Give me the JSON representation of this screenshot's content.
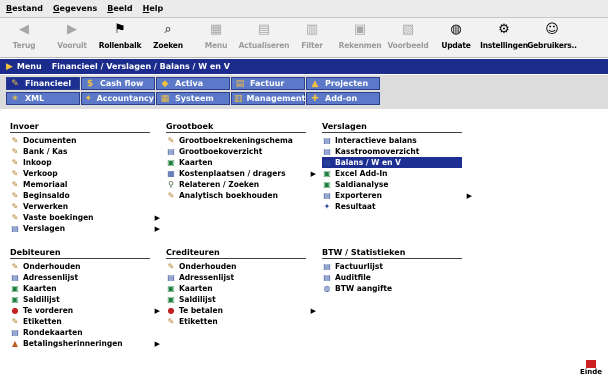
{
  "menubar": [
    "Bestand",
    "Gegevens",
    "Beeld",
    "Help"
  ],
  "toolbar": [
    {
      "label": "Terug",
      "icon": "back-icon",
      "glyph": "◀",
      "enabled": false
    },
    {
      "label": "Vooruit",
      "icon": "forward-icon",
      "glyph": "▶",
      "enabled": false
    },
    {
      "label": "Rollenbalk",
      "icon": "rollenbalk-icon",
      "glyph": "⚑",
      "enabled": true
    },
    {
      "label": "Zoeken",
      "icon": "search-icon",
      "glyph": "⌕",
      "enabled": true
    },
    {
      "label": "Menu",
      "icon": "menu-grid-icon",
      "glyph": "▦",
      "enabled": false
    },
    {
      "label": "Actualiseren",
      "icon": "refresh-icon",
      "glyph": "▤",
      "enabled": false
    },
    {
      "label": "Filter",
      "icon": "filter-icon",
      "glyph": "▥",
      "enabled": false
    },
    {
      "label": "Rekenmen",
      "icon": "calculator-icon",
      "glyph": "▣",
      "enabled": false
    },
    {
      "label": "Voorbeeld",
      "icon": "preview-icon",
      "glyph": "▧",
      "enabled": false
    },
    {
      "label": "Update",
      "icon": "globe-icon",
      "glyph": "◍",
      "enabled": true
    },
    {
      "label": "Instellingen",
      "icon": "gear-icon",
      "glyph": "⚙",
      "enabled": true
    },
    {
      "label": "Gebruikers..",
      "icon": "users-icon",
      "glyph": "☺",
      "enabled": true
    }
  ],
  "breadcrumb": {
    "menu": "Menu",
    "path": "Financieel / Verslagen / Balans / W en V"
  },
  "tabs_row1": [
    {
      "label": "Financieel",
      "icon": "bookkeeping-icon",
      "glyph": "✎",
      "active": true
    },
    {
      "label": "Cash flow",
      "icon": "cash-flow-icon",
      "glyph": "$"
    },
    {
      "label": "Activa",
      "icon": "activa-icon",
      "glyph": "◆"
    },
    {
      "label": "Factuur",
      "icon": "invoice-icon",
      "glyph": "▤"
    },
    {
      "label": "Projecten",
      "icon": "projects-icon",
      "glyph": "▲"
    }
  ],
  "tabs_row2": [
    {
      "label": "XML",
      "icon": "xml-icon",
      "glyph": "✶"
    },
    {
      "label": "Accountancy",
      "icon": "accountancy-icon",
      "glyph": "✦"
    },
    {
      "label": "Systeem",
      "icon": "system-icon",
      "glyph": "▦"
    },
    {
      "label": "Management",
      "icon": "management-icon",
      "glyph": "▥"
    },
    {
      "label": "Add-on",
      "icon": "add-on-icon",
      "glyph": "✚"
    }
  ],
  "groups": [
    {
      "title": "Invoer",
      "items": [
        {
          "label": "Documenten",
          "icon": "document-icon",
          "glyph": "✎",
          "color": "#b07a20"
        },
        {
          "label": "Bank / Kas",
          "icon": "bank-icon",
          "glyph": "✎",
          "color": "#b07a20"
        },
        {
          "label": "Inkoop",
          "icon": "purchase-icon",
          "glyph": "✎",
          "color": "#b07a20"
        },
        {
          "label": "Verkoop",
          "icon": "sales-icon",
          "glyph": "✎",
          "color": "#b07a20"
        },
        {
          "label": "Memoriaal",
          "icon": "memorial-icon",
          "glyph": "✎",
          "color": "#b07a20"
        },
        {
          "label": "Beginsaldo",
          "icon": "opening-balance-icon",
          "glyph": "✎",
          "color": "#b07a20"
        },
        {
          "label": "Verwerken",
          "icon": "process-icon",
          "glyph": "✎",
          "color": "#b07a20"
        },
        {
          "label": "Vaste boekingen",
          "icon": "fixed-entries-icon",
          "glyph": "✎",
          "color": "#b07a20",
          "submenu": true
        },
        {
          "label": "Verslagen",
          "icon": "reports-icon",
          "glyph": "▤",
          "color": "#3050a0",
          "submenu": true
        }
      ]
    },
    {
      "title": "Grootboek",
      "items": [
        {
          "label": "Grootboekrekeningschema",
          "icon": "ledger-schema-icon",
          "glyph": "✎",
          "color": "#b07a20"
        },
        {
          "label": "Grootboekoverzicht",
          "icon": "ledger-overview-icon",
          "glyph": "▤",
          "color": "#3050a0"
        },
        {
          "label": "Kaarten",
          "icon": "cards-icon",
          "glyph": "▣",
          "color": "#208040"
        },
        {
          "label": "Kostenplaatsen / dragers",
          "icon": "cost-centers-icon",
          "glyph": "▦",
          "color": "#3050a0",
          "submenu": true
        },
        {
          "label": "Relateren / Zoeken",
          "icon": "relate-search-icon",
          "glyph": "⚲",
          "color": "#406040"
        },
        {
          "label": "Analytisch boekhouden",
          "icon": "analytical-icon",
          "glyph": "✎",
          "color": "#b07a20"
        }
      ]
    },
    {
      "title": "Verslagen",
      "items": [
        {
          "label": "Interactieve balans",
          "icon": "interactive-balance-icon",
          "glyph": "▤",
          "color": "#3050a0"
        },
        {
          "label": "Kasstroomoverzicht",
          "icon": "cash-flow-statement-icon",
          "glyph": "▤",
          "color": "#3050a0"
        },
        {
          "label": "Balans / W en V",
          "icon": "balance-icon",
          "glyph": "▤",
          "color": "#3050a0",
          "selected": true
        },
        {
          "label": "Excel Add-In",
          "icon": "excel-icon",
          "glyph": "▣",
          "color": "#208040"
        },
        {
          "label": "Saldianalyse",
          "icon": "balance-analysis-icon",
          "glyph": "▣",
          "color": "#208040"
        },
        {
          "label": "Exporteren",
          "icon": "export-icon",
          "glyph": "▤",
          "color": "#3050a0",
          "submenu": true
        },
        {
          "label": "Resultaat",
          "icon": "result-icon",
          "glyph": "✦",
          "color": "#3050a0"
        }
      ]
    },
    {
      "title": "Debiteuren",
      "items": [
        {
          "label": "Onderhouden",
          "icon": "maintain-icon",
          "glyph": "✎",
          "color": "#b07a20"
        },
        {
          "label": "Adressenlijst",
          "icon": "address-list-icon",
          "glyph": "▤",
          "color": "#3050a0"
        },
        {
          "label": "Kaarten",
          "icon": "cards-icon",
          "glyph": "▣",
          "color": "#208040"
        },
        {
          "label": "Saldilijst",
          "icon": "balance-list-icon",
          "glyph": "▣",
          "color": "#208040"
        },
        {
          "label": "Te vorderen",
          "icon": "receivable-icon",
          "glyph": "●",
          "color": "#c02020",
          "submenu": true
        },
        {
          "label": "Etiketten",
          "icon": "labels-icon",
          "glyph": "✎",
          "color": "#b07a20"
        },
        {
          "label": "Rondekaarten",
          "icon": "cards-round-icon",
          "glyph": "▤",
          "color": "#3050a0"
        },
        {
          "label": "Betalingsherinneringen",
          "icon": "reminder-icon",
          "glyph": "▲",
          "color": "#c06020",
          "submenu": true
        }
      ]
    },
    {
      "title": "Crediteuren",
      "items": [
        {
          "label": "Onderhouden",
          "icon": "maintain-icon",
          "glyph": "✎",
          "color": "#b07a20"
        },
        {
          "label": "Adressenlijst",
          "icon": "address-list-icon",
          "glyph": "▤",
          "color": "#3050a0"
        },
        {
          "label": "Kaarten",
          "icon": "cards-icon",
          "glyph": "▣",
          "color": "#208040"
        },
        {
          "label": "Saldilijst",
          "icon": "balance-list-icon",
          "glyph": "▣",
          "color": "#208040"
        },
        {
          "label": "Te betalen",
          "icon": "payable-icon",
          "glyph": "●",
          "color": "#c02020",
          "submenu": true
        },
        {
          "label": "Etiketten",
          "icon": "labels-icon",
          "glyph": "✎",
          "color": "#b07a20"
        }
      ]
    },
    {
      "title": "BTW / Statistieken",
      "items": [
        {
          "label": "Factuurlijst",
          "icon": "invoice-list-icon",
          "glyph": "▤",
          "color": "#3050a0"
        },
        {
          "label": "Auditfile",
          "icon": "auditfile-icon",
          "glyph": "▤",
          "color": "#3050a0"
        },
        {
          "label": "BTW aangifte",
          "icon": "vat-icon",
          "glyph": "◍",
          "color": "#3050a0"
        }
      ]
    }
  ],
  "stop": {
    "label": "Einde",
    "icon": "stop-icon"
  }
}
